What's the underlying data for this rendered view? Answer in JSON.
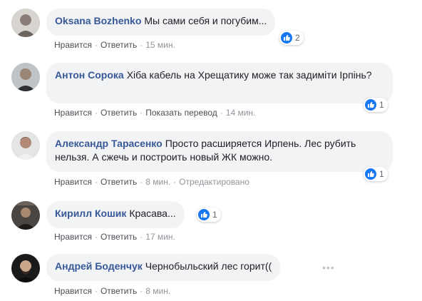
{
  "colors": {
    "like": "#1877f2",
    "author": "#385898",
    "bubble": "#f2f3f5"
  },
  "actions": {
    "like": "Нравится",
    "reply": "Ответить",
    "translate": "Показать перевод",
    "edited": "Отредактировано",
    "separator": "·"
  },
  "comments": [
    {
      "author": "Oksana Bozhenko",
      "text": "Мы сами себя и погубим...",
      "time": "15 мин.",
      "reactions": "2"
    },
    {
      "author": "Антон Сорока",
      "text": "Хіба кабель на Хрещатику може так задиміти Ірпінь?",
      "time": "14 мин.",
      "reactions": "1"
    },
    {
      "author": "Александр Тарасенко",
      "text": "Просто расширяется Ирпень. Лес рубить нельзя. А сжечь и построить новый ЖК можно.",
      "time": "8 мин.",
      "reactions": "1"
    },
    {
      "author": "Кирилл Кошик",
      "text": "Красава...",
      "time": "17 мин.",
      "reactions": "1"
    },
    {
      "author": "Андрей Боденчук",
      "text": "Чернобыльский лес горит((",
      "time": "8 мин."
    }
  ],
  "icons": {
    "like": "thumbs-up-icon",
    "more": "more-options-icon"
  }
}
